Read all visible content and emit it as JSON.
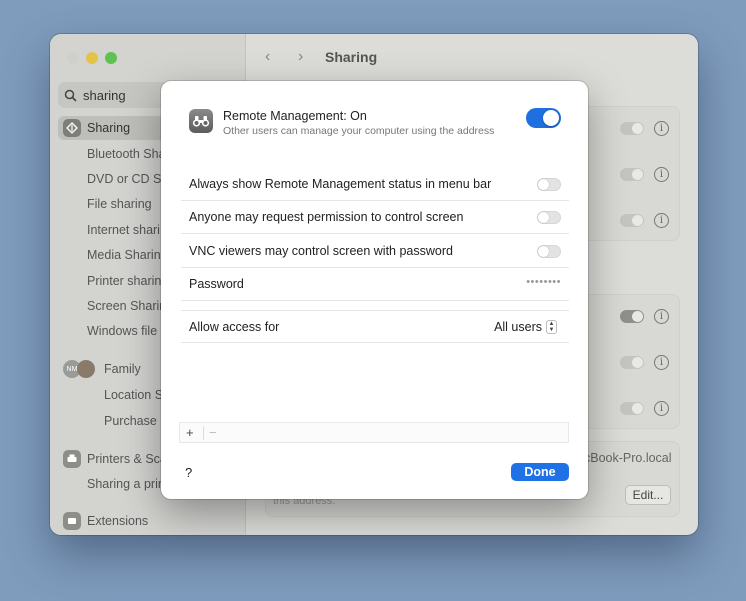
{
  "window": {
    "title": "Sharing",
    "search": {
      "value": "sharing"
    },
    "sidebar": {
      "selected": "Sharing",
      "items": [
        {
          "label": "Sharing"
        },
        {
          "label": "Bluetooth Sha"
        },
        {
          "label": "DVD or CD Sh"
        },
        {
          "label": "File sharing"
        },
        {
          "label": "Internet shari"
        },
        {
          "label": "Media Sharin"
        },
        {
          "label": "Printer sharin"
        },
        {
          "label": "Screen Sharin"
        },
        {
          "label": "Windows file s"
        },
        {
          "label": "Family"
        },
        {
          "label": "Location S"
        },
        {
          "label": "Purchase S"
        },
        {
          "label": "Printers & Sca"
        },
        {
          "label": "Sharing a prin"
        },
        {
          "label": "Extensions"
        }
      ],
      "family_avatar_initials": "NM"
    },
    "background": {
      "hostname_fragment": "cBook-Pro.local",
      "address_fragment": "this address.",
      "edit_label": "Edit..."
    }
  },
  "dialog": {
    "title": "Remote Management: On",
    "subtitle": "Other users can manage your computer using the address",
    "enabled": true,
    "options": [
      {
        "label": "Always show Remote Management status in menu bar",
        "enabled": false
      },
      {
        "label": "Anyone may request permission to control screen",
        "enabled": false
      },
      {
        "label": "VNC viewers may control screen with password",
        "enabled": false
      }
    ],
    "password": {
      "label": "Password",
      "value": "••••••••"
    },
    "access": {
      "label": "Allow access for",
      "value": "All users"
    },
    "list": {
      "add": "+",
      "remove": "−"
    },
    "help": "?",
    "done": "Done"
  }
}
